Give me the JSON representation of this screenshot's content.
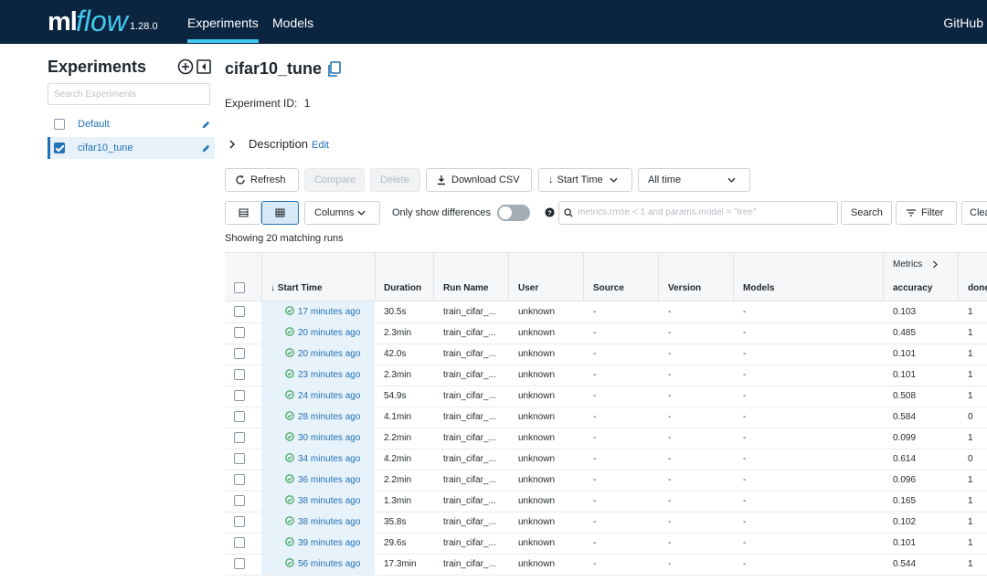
{
  "topbar": {
    "logo_ml": "ml",
    "logo_flow": "flow",
    "version": "1.28.0",
    "nav": [
      "Experiments",
      "Models"
    ],
    "github": "GitHub"
  },
  "sidebar": {
    "title": "Experiments",
    "search_placeholder": "Search Experiments",
    "items": [
      {
        "label": "Default",
        "checked": false
      },
      {
        "label": "cifar10_tune",
        "checked": true
      }
    ]
  },
  "experiment": {
    "name": "cifar10_tune",
    "id_label": "Experiment ID:",
    "id_value": "1",
    "description_label": "Description",
    "edit_label": "Edit"
  },
  "toolbar": {
    "refresh": "Refresh",
    "compare": "Compare",
    "delete": "Delete",
    "download": "Download CSV",
    "sort": "Start Time",
    "time_range": "All time",
    "columns": "Columns",
    "only_diff": "Only show differences",
    "search_placeholder": "metrics.rmse < 1 and params.model = \"tree\"",
    "search": "Search",
    "filter": "Filter",
    "clear": "Clea"
  },
  "showing": "Showing 20 matching runs",
  "table": {
    "metrics_group": "Metrics",
    "headers": [
      "Start Time",
      "Duration",
      "Run Name",
      "User",
      "Source",
      "Version",
      "Models",
      "accuracy",
      "done"
    ],
    "rows": [
      {
        "time": "17 minutes ago",
        "duration": "30.5s",
        "run": "train_cifar_...",
        "user": "unknown",
        "source": "-",
        "version": "-",
        "models": "-",
        "accuracy": "0.103",
        "done": "1"
      },
      {
        "time": "20 minutes ago",
        "duration": "2.3min",
        "run": "train_cifar_...",
        "user": "unknown",
        "source": "-",
        "version": "-",
        "models": "-",
        "accuracy": "0.485",
        "done": "1"
      },
      {
        "time": "20 minutes ago",
        "duration": "42.0s",
        "run": "train_cifar_...",
        "user": "unknown",
        "source": "-",
        "version": "-",
        "models": "-",
        "accuracy": "0.101",
        "done": "1"
      },
      {
        "time": "23 minutes ago",
        "duration": "2.3min",
        "run": "train_cifar_...",
        "user": "unknown",
        "source": "-",
        "version": "-",
        "models": "-",
        "accuracy": "0.101",
        "done": "1"
      },
      {
        "time": "24 minutes ago",
        "duration": "54.9s",
        "run": "train_cifar_...",
        "user": "unknown",
        "source": "-",
        "version": "-",
        "models": "-",
        "accuracy": "0.508",
        "done": "1"
      },
      {
        "time": "28 minutes ago",
        "duration": "4.1min",
        "run": "train_cifar_...",
        "user": "unknown",
        "source": "-",
        "version": "-",
        "models": "-",
        "accuracy": "0.584",
        "done": "0"
      },
      {
        "time": "30 minutes ago",
        "duration": "2.2min",
        "run": "train_cifar_...",
        "user": "unknown",
        "source": "-",
        "version": "-",
        "models": "-",
        "accuracy": "0.099",
        "done": "1"
      },
      {
        "time": "34 minutes ago",
        "duration": "4.2min",
        "run": "train_cifar_...",
        "user": "unknown",
        "source": "-",
        "version": "-",
        "models": "-",
        "accuracy": "0.614",
        "done": "0"
      },
      {
        "time": "36 minutes ago",
        "duration": "2.2min",
        "run": "train_cifar_...",
        "user": "unknown",
        "source": "-",
        "version": "-",
        "models": "-",
        "accuracy": "0.096",
        "done": "1"
      },
      {
        "time": "38 minutes ago",
        "duration": "1.3min",
        "run": "train_cifar_...",
        "user": "unknown",
        "source": "-",
        "version": "-",
        "models": "-",
        "accuracy": "0.165",
        "done": "1"
      },
      {
        "time": "38 minutes ago",
        "duration": "35.8s",
        "run": "train_cifar_...",
        "user": "unknown",
        "source": "-",
        "version": "-",
        "models": "-",
        "accuracy": "0.102",
        "done": "1"
      },
      {
        "time": "39 minutes ago",
        "duration": "29.6s",
        "run": "train_cifar_...",
        "user": "unknown",
        "source": "-",
        "version": "-",
        "models": "-",
        "accuracy": "0.101",
        "done": "1"
      },
      {
        "time": "56 minutes ago",
        "duration": "17.3min",
        "run": "train_cifar_...",
        "user": "unknown",
        "source": "-",
        "version": "-",
        "models": "-",
        "accuracy": "0.544",
        "done": "1"
      }
    ]
  },
  "colors": {
    "topbar": "#0b2440",
    "accent": "#43c9ed",
    "link": "#2272b4",
    "success": "#2e9b4d"
  }
}
